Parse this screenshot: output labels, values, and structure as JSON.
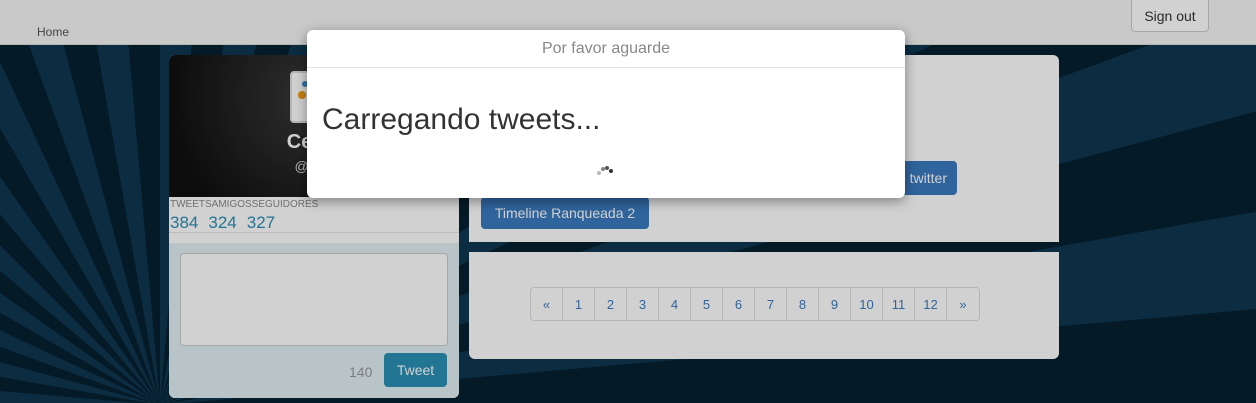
{
  "navbar": {
    "home_label": "Home",
    "signout_label": "Sign out"
  },
  "profile": {
    "name": "Celso",
    "handle": "@cels",
    "stats_labels": "TWEETSAMIGOSSEGUIDORES",
    "stats": [
      "384",
      "324",
      "327"
    ]
  },
  "compose": {
    "char_count": "140",
    "tweet_label": "Tweet"
  },
  "main": {
    "twitter_button_label": "twitter",
    "ranked_button_label": "Timeline Ranqueada 2"
  },
  "pagination": {
    "prev_label": "«",
    "pages": [
      "1",
      "2",
      "3",
      "4",
      "5",
      "6",
      "7",
      "8",
      "9",
      "10",
      "11",
      "12"
    ],
    "next_label": "»"
  },
  "modal": {
    "title": "Por favor aguarde",
    "message": "Carregando tweets..."
  },
  "colors": {
    "accent": "#2b8fb5",
    "button_blue": "#3a7bbf"
  }
}
